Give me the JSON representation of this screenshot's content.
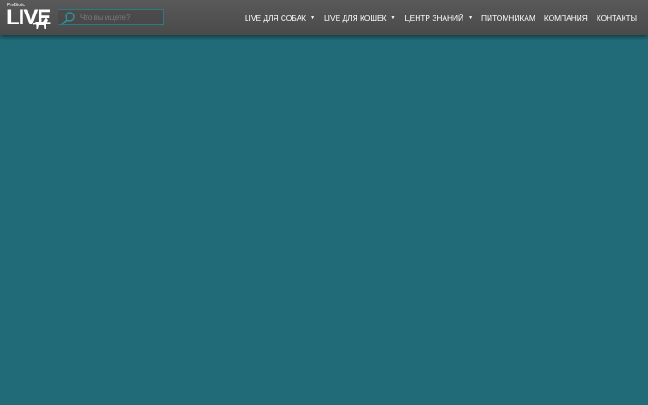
{
  "header": {
    "logo": {
      "small_text": "ProBiotic",
      "big_text": "LIVE"
    },
    "search": {
      "placeholder": "Что вы ищете?",
      "value": ""
    },
    "nav": [
      {
        "label": "LIVE ДЛЯ СОБАК",
        "caret": "▼"
      },
      {
        "label": "LIVE ДЛЯ КОШЕК",
        "caret": "▼"
      },
      {
        "label": "ЦЕНТР ЗНАНИЙ",
        "caret": "▼"
      },
      {
        "label": "ПИТОМНИКАМ",
        "caret": ""
      },
      {
        "label": "КОМПАНИЯ",
        "caret": ""
      },
      {
        "label": "КОНТАКТЫ",
        "caret": ""
      }
    ]
  },
  "colors": {
    "header_bg": "#555555",
    "main_bg": "#216a77",
    "search_border": "#2b7b86",
    "nav_text": "#ffffff"
  },
  "icons": {
    "search": "search-icon",
    "logo_dog": "dog-silhouette-icon",
    "dropdown": "caret-down-icon"
  }
}
